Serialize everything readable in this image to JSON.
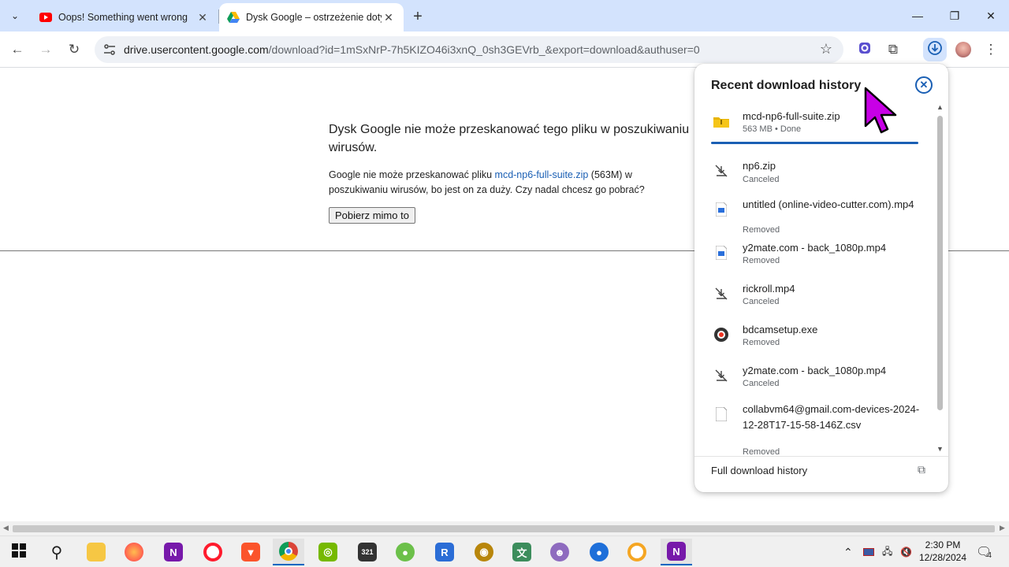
{
  "tabs": [
    {
      "title": "Oops! Something went wrong",
      "favicon": "youtube-icon",
      "active": false
    },
    {
      "title": "Dysk Google – ostrzeżenie dotyczące",
      "favicon": "google-drive-icon",
      "active": true
    }
  ],
  "window_controls": {
    "minimize": "—",
    "maximize": "❐",
    "close": "✕"
  },
  "address_bar": {
    "host": "drive.usercontent.google.com",
    "path": "/download?id=1mSxNrP-7h5KIZO46i3xnQ_0sh3GEVrb_&export=download&authuser=0"
  },
  "page": {
    "heading": "Dysk Google nie może przeskanować tego pliku w poszukiwaniu wirusów.",
    "text_before": "Google nie może przeskanować pliku ",
    "file_link": "mcd-np6-full-suite.zip",
    "text_after": " (563M) w poszukiwaniu wirusów, bo jest on za duży. Czy nadal chcesz go pobrać?",
    "download_button": "Pobierz mimo to"
  },
  "downloads_panel": {
    "title": "Recent download history",
    "items": [
      {
        "name": "mcd-np6-full-suite.zip",
        "status": "563 MB • Done",
        "icon": "zip-folder-icon"
      },
      {
        "name": "np6.zip",
        "status": "Canceled",
        "icon": "canceled-icon"
      },
      {
        "name": "untitled (online-video-cutter.com).mp4",
        "status": "Removed",
        "icon": "video-file-icon"
      },
      {
        "name": "y2mate.com - back_1080p.mp4",
        "status": "Removed",
        "icon": "video-file-icon"
      },
      {
        "name": "rickroll.mp4",
        "status": "Canceled",
        "icon": "canceled-icon"
      },
      {
        "name": "bdcamsetup.exe",
        "status": "Removed",
        "icon": "bandicam-icon"
      },
      {
        "name": "y2mate.com - back_1080p.mp4",
        "status": "Canceled",
        "icon": "canceled-icon"
      },
      {
        "name": "collabvm64@gmail.com-devices-2024-12-28T17-15-58-146Z.csv",
        "status": "Removed",
        "icon": "file-icon"
      }
    ],
    "footer": "Full download history"
  },
  "clock": {
    "time": "2:30 PM",
    "date": "12/28/2024"
  },
  "notifications_count": "4",
  "colors": {
    "accent": "#1a5fb4",
    "tabstrip": "#d3e3fd",
    "cursor": "#c800e6"
  }
}
